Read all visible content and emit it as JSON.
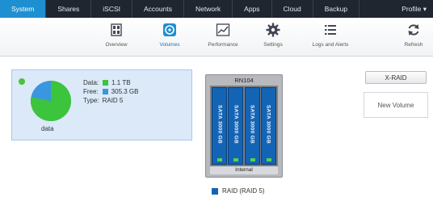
{
  "nav": {
    "tabs": [
      "System",
      "Shares",
      "iSCSI",
      "Accounts",
      "Network",
      "Apps",
      "Cloud",
      "Backup"
    ],
    "active": "System",
    "profile_label": "Profile ▾"
  },
  "toolbar": {
    "items": [
      {
        "label": "Overview",
        "icon": "overview-icon"
      },
      {
        "label": "Volumes",
        "icon": "volumes-icon"
      },
      {
        "label": "Performance",
        "icon": "performance-icon"
      },
      {
        "label": "Settings",
        "icon": "settings-icon"
      },
      {
        "label": "Logs and Alerts",
        "icon": "logs-icon"
      }
    ],
    "refresh_label": "Refresh"
  },
  "volume": {
    "name": "data",
    "data_label": "Data:",
    "data_value": "1.1 TB",
    "free_label": "Free:",
    "free_value": "305.3 GB",
    "type_label": "Type:",
    "type_value": "RAID 5",
    "used_fraction": 0.78,
    "colors": {
      "data": "#3cc43c",
      "free": "#3a96df",
      "status": "#4cc13a"
    }
  },
  "enclosure": {
    "title": "RN104",
    "disks": [
      "SATA 3000 GB",
      "SATA 3000 GB",
      "SATA 3000 GB",
      "SATA 3000 GB"
    ],
    "footer": "Internal",
    "color": "#1464b5"
  },
  "legend": {
    "label": "RAID (RAID 5)"
  },
  "actions": {
    "raid_label": "X-RAID",
    "new_volume_label": "New Volume"
  }
}
